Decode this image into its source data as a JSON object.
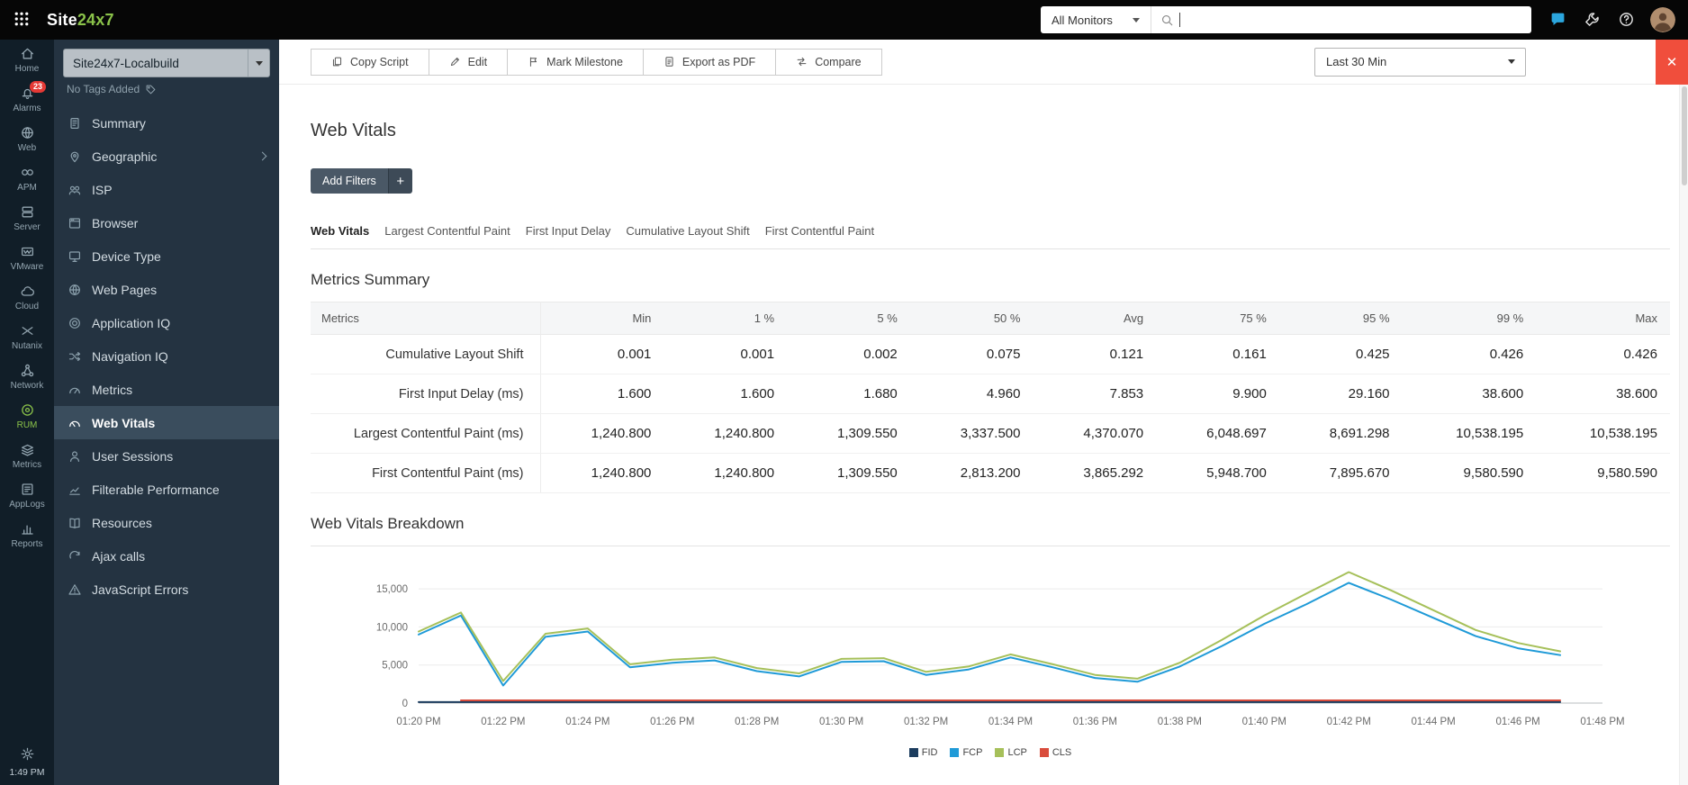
{
  "topbar": {
    "brand_prefix": "Site",
    "brand_suffix": "24x7",
    "monitors_label": "All Monitors",
    "search_value": ""
  },
  "rail": {
    "items": [
      {
        "id": "home",
        "label": "Home"
      },
      {
        "id": "alarms",
        "label": "Alarms",
        "badge": "23"
      },
      {
        "id": "web",
        "label": "Web"
      },
      {
        "id": "apm",
        "label": "APM"
      },
      {
        "id": "server",
        "label": "Server"
      },
      {
        "id": "vmware",
        "label": "VMware"
      },
      {
        "id": "cloud",
        "label": "Cloud"
      },
      {
        "id": "nutanix",
        "label": "Nutanix"
      },
      {
        "id": "network",
        "label": "Network"
      },
      {
        "id": "rum",
        "label": "RUM",
        "active": true
      },
      {
        "id": "metrics",
        "label": "Metrics"
      },
      {
        "id": "applogs",
        "label": "AppLogs"
      },
      {
        "id": "reports",
        "label": "Reports"
      }
    ],
    "time": "1:49 PM"
  },
  "sidebar": {
    "monitor_name": "Site24x7-Localbuild",
    "tags_label": "No Tags Added",
    "items": [
      {
        "id": "summary",
        "icon": "summary",
        "label": "Summary"
      },
      {
        "id": "geographic",
        "icon": "geographic",
        "label": "Geographic",
        "chevron": true
      },
      {
        "id": "isp",
        "icon": "isp",
        "label": "ISP"
      },
      {
        "id": "browser",
        "icon": "browser",
        "label": "Browser"
      },
      {
        "id": "device-type",
        "icon": "device-type",
        "label": "Device Type"
      },
      {
        "id": "web-pages",
        "icon": "web-pages",
        "label": "Web Pages"
      },
      {
        "id": "application-iq",
        "icon": "application-iq",
        "label": "Application IQ"
      },
      {
        "id": "navigation-iq",
        "icon": "navigation-iq",
        "label": "Navigation IQ"
      },
      {
        "id": "metrics",
        "icon": "metrics-side",
        "label": "Metrics"
      },
      {
        "id": "web-vitals",
        "icon": "web-vitals",
        "label": "Web Vitals",
        "active": true
      },
      {
        "id": "user-sessions",
        "icon": "user-sessions",
        "label": "User Sessions"
      },
      {
        "id": "filterable-performance",
        "icon": "filterable-performance",
        "label": "Filterable Performance"
      },
      {
        "id": "resources",
        "icon": "resources",
        "label": "Resources"
      },
      {
        "id": "ajax-calls",
        "icon": "ajax-calls",
        "label": "Ajax calls"
      },
      {
        "id": "javascript-errors",
        "icon": "javascript-errors",
        "label": "JavaScript Errors"
      }
    ]
  },
  "toolbar": {
    "buttons": [
      {
        "id": "copy-script",
        "label": "Copy Script"
      },
      {
        "id": "edit",
        "label": "Edit"
      },
      {
        "id": "mark-milestone",
        "label": "Mark Milestone"
      },
      {
        "id": "export-pdf",
        "label": "Export as PDF"
      },
      {
        "id": "compare",
        "label": "Compare"
      }
    ],
    "time_range": "Last 30 Min",
    "close": "✕"
  },
  "page": {
    "title": "Web Vitals",
    "add_filters": "Add Filters",
    "add_filters_plus": "+"
  },
  "tabs": [
    {
      "label": "Web Vitals",
      "active": true
    },
    {
      "label": "Largest Contentful Paint"
    },
    {
      "label": "First Input Delay"
    },
    {
      "label": "Cumulative Layout Shift"
    },
    {
      "label": "First Contentful Paint"
    }
  ],
  "metrics_summary": {
    "title": "Metrics Summary",
    "columns": [
      "Metrics",
      "Min",
      "1 %",
      "5 %",
      "50 %",
      "Avg",
      "75 %",
      "95 %",
      "99 %",
      "Max"
    ],
    "rows": [
      {
        "metric": "Cumulative Layout Shift",
        "values": [
          "0.001",
          "0.001",
          "0.002",
          "0.075",
          "0.121",
          "0.161",
          "0.425",
          "0.426",
          "0.426"
        ]
      },
      {
        "metric": "First Input Delay (ms)",
        "values": [
          "1.600",
          "1.600",
          "1.680",
          "4.960",
          "7.853",
          "9.900",
          "29.160",
          "38.600",
          "38.600"
        ]
      },
      {
        "metric": "Largest Contentful Paint (ms)",
        "values": [
          "1,240.800",
          "1,240.800",
          "1,309.550",
          "3,337.500",
          "4,370.070",
          "6,048.697",
          "8,691.298",
          "10,538.195",
          "10,538.195"
        ]
      },
      {
        "metric": "First Contentful Paint (ms)",
        "values": [
          "1,240.800",
          "1,240.800",
          "1,309.550",
          "2,813.200",
          "3,865.292",
          "5,948.700",
          "7,895.670",
          "9,580.590",
          "9,580.590"
        ]
      }
    ]
  },
  "chart_data": {
    "type": "line",
    "title": "Web Vitals Breakdown",
    "x_start": "01:20 PM",
    "x_step_minutes": 1,
    "x_tick_labels": [
      "01:20 PM",
      "01:22 PM",
      "01:24 PM",
      "01:26 PM",
      "01:28 PM",
      "01:30 PM",
      "01:32 PM",
      "01:34 PM",
      "01:36 PM",
      "01:38 PM",
      "01:40 PM",
      "01:42 PM",
      "01:44 PM",
      "01:46 PM",
      "01:48 PM"
    ],
    "ylim": [
      0,
      17500
    ],
    "yticks": [
      0,
      5000,
      10000,
      15000
    ],
    "grid": true,
    "legend_position": "bottom",
    "series": [
      {
        "name": "FID",
        "color": "#1c3c5e",
        "values": [
          8,
          8,
          8,
          8,
          8,
          8,
          8,
          8,
          8,
          8,
          8,
          8,
          8,
          8,
          8,
          8,
          8,
          8,
          8,
          8,
          8,
          8,
          8,
          8,
          8,
          8,
          8,
          8
        ]
      },
      {
        "name": "FCP",
        "color": "#1f9ad7",
        "values": [
          9000,
          11500,
          2300,
          8700,
          9400,
          4700,
          5300,
          5600,
          4200,
          3500,
          5400,
          5500,
          3700,
          4400,
          6000,
          4700,
          3300,
          2800,
          4800,
          7500,
          10400,
          13000,
          15800,
          13600,
          11200,
          8800,
          7200,
          6300
        ]
      },
      {
        "name": "LCP",
        "color": "#a6c05a",
        "values": [
          9400,
          11900,
          2900,
          9100,
          9800,
          5100,
          5700,
          6000,
          4600,
          3900,
          5800,
          5900,
          4100,
          4800,
          6400,
          5100,
          3700,
          3200,
          5300,
          8300,
          11500,
          14400,
          17200,
          14800,
          12200,
          9600,
          7900,
          6800
        ]
      },
      {
        "name": "CLS",
        "color": "#d94c3c",
        "values": [
          null,
          0.4,
          0.4,
          0.4,
          0.4,
          0.4,
          0.4,
          0.4,
          0.4,
          0.4,
          0.4,
          0.4,
          0.4,
          0.4,
          0.4,
          0.4,
          0.4,
          0.4,
          0.4,
          0.4,
          0.4,
          0.4,
          0.4,
          0.4,
          0.4,
          0.4,
          0.4,
          0.4
        ]
      }
    ]
  }
}
